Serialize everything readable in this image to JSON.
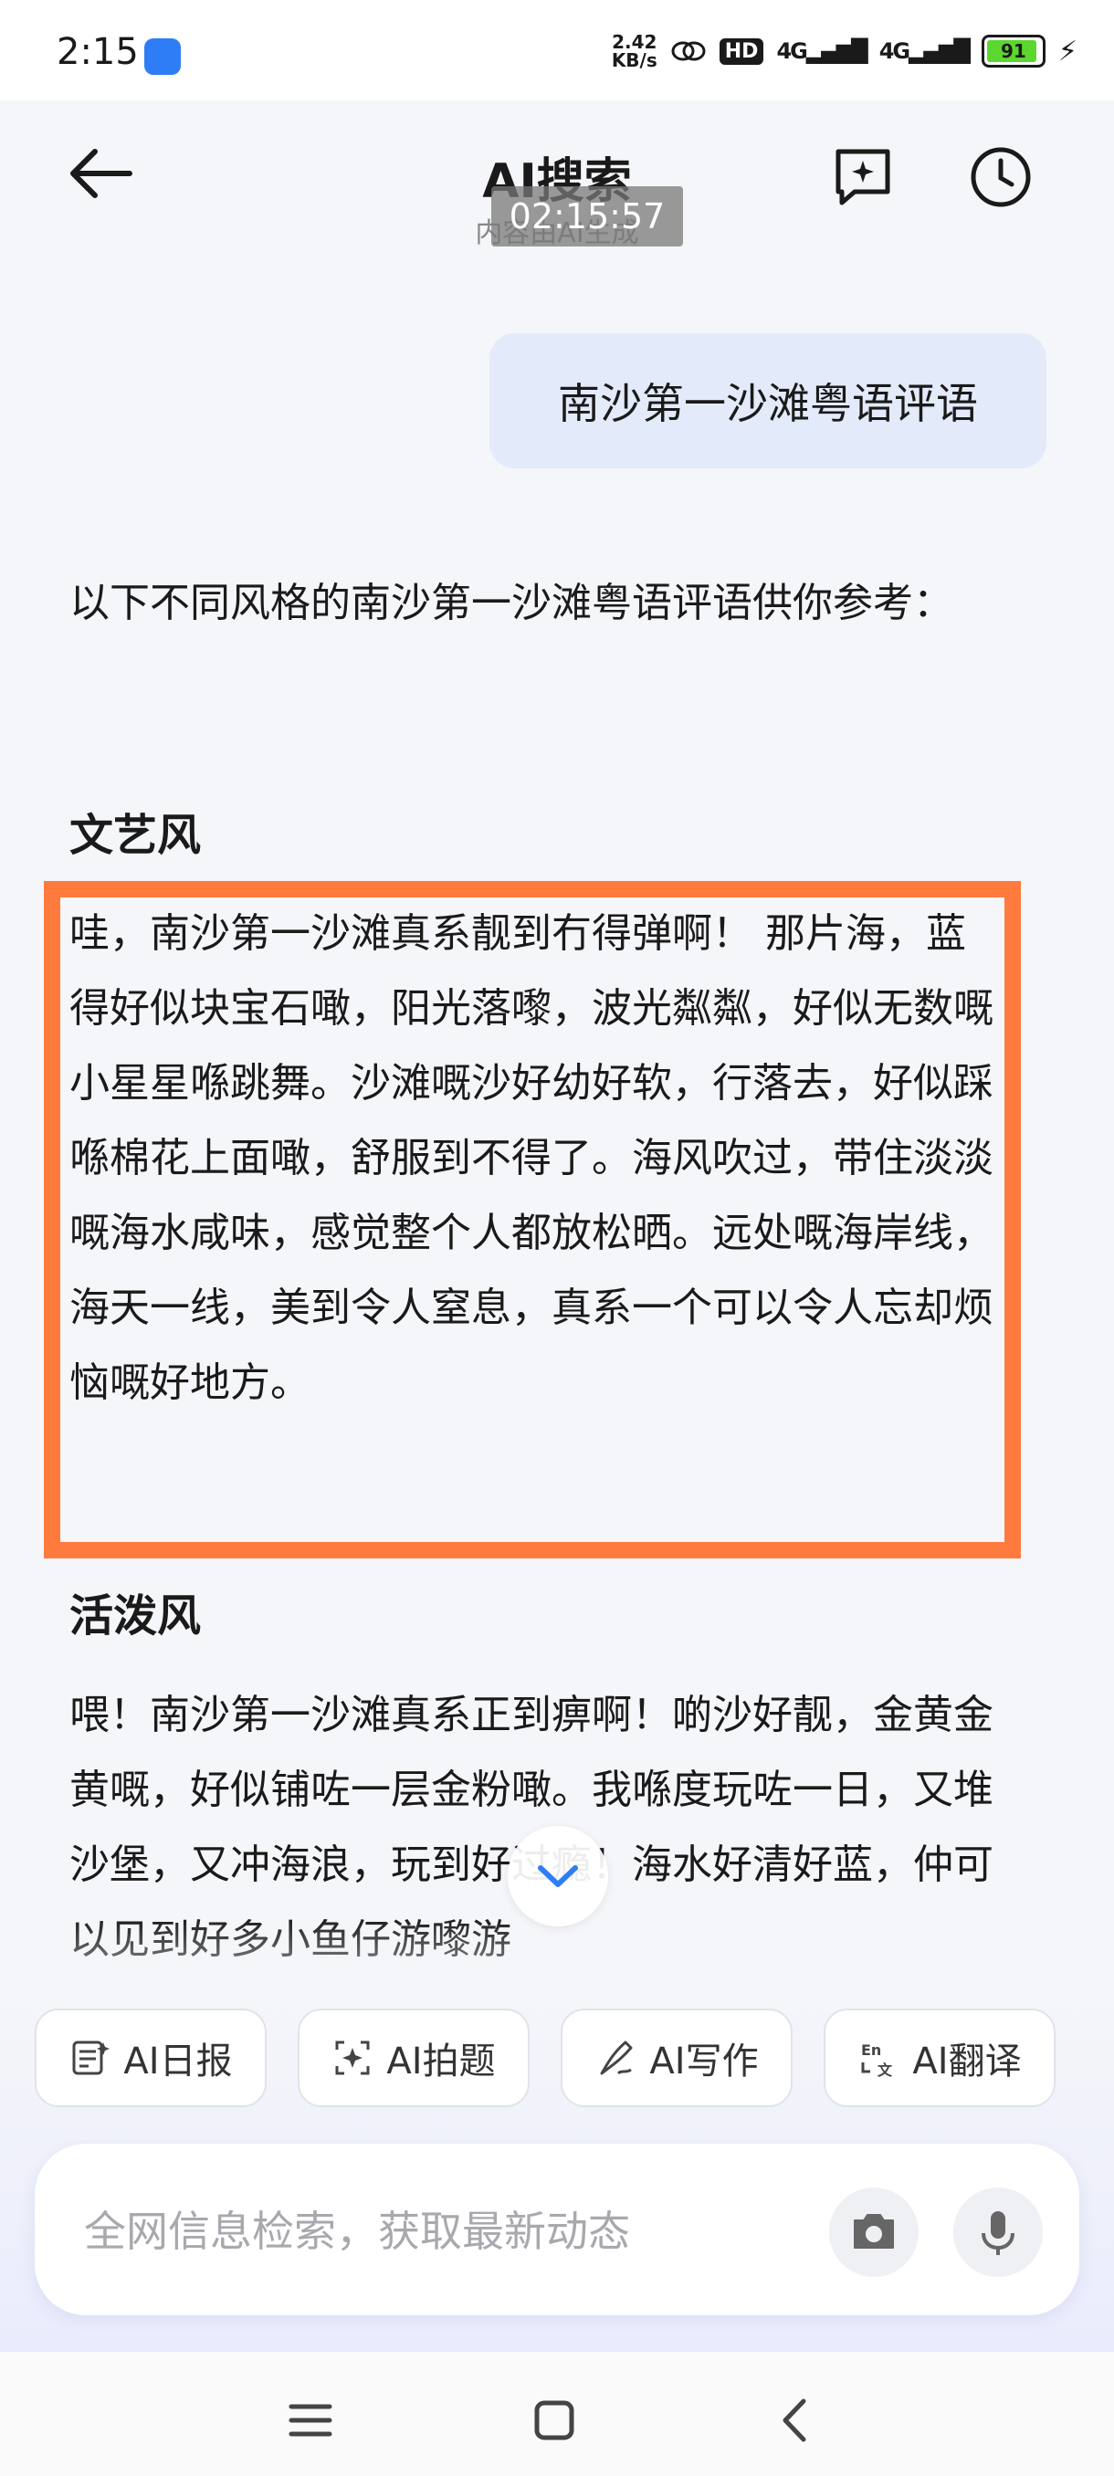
{
  "status": {
    "time": "2:15",
    "net_speed_value": "2.42",
    "net_speed_unit": "KB/s",
    "hd": "HD",
    "signal1": "4G",
    "signal2": "4G",
    "battery": "91"
  },
  "header": {
    "title": "AI搜索",
    "subtitle": "内容由AI生成",
    "timestamp": "02:15:57"
  },
  "conversation": {
    "user_query": "南沙第一沙滩粤语评语",
    "intro": "以下不同风格的南沙第一沙滩粤语评语供你参考：",
    "sections": [
      {
        "heading": "文艺风",
        "text": "哇，南沙第一沙滩真系靓到冇得弹啊！ 那片海，蓝得好似块宝石噉，阳光落嚟，波光粼粼，好似无数嘅小星星喺跳舞。沙滩嘅沙好幼好软，行落去，好似踩喺棉花上面噉，舒服到不得了。海风吹过，带住淡淡嘅海水咸味，感觉整个人都放松晒。远处嘅海岸线，海天一线，美到令人窒息，真系一个可以令人忘却烦恼嘅好地方。"
      },
      {
        "heading": "活泼风",
        "text": "喂！南沙第一沙滩真系正到痹啊！啲沙好靓，金黄金黄嘅，好似铺咗一层金粉噉。我喺度玩咗一日，又堆沙堡，又冲海浪，玩到好过瘾！海水好清好蓝，仲可以见到好多小鱼仔游嚟游"
      }
    ]
  },
  "quick_actions": [
    {
      "label": "AI日报",
      "icon": "daily-report-icon"
    },
    {
      "label": "AI拍题",
      "icon": "photo-question-icon"
    },
    {
      "label": "AI写作",
      "icon": "pen-writing-icon"
    },
    {
      "label": "AI翻译",
      "icon": "translate-icon"
    }
  ],
  "input": {
    "placeholder": "全网信息检索，获取最新动态"
  },
  "colors": {
    "highlight_border": "#ff7a3d",
    "user_bubble": "#e3eafa",
    "accent_blue": "#2f7df6"
  }
}
